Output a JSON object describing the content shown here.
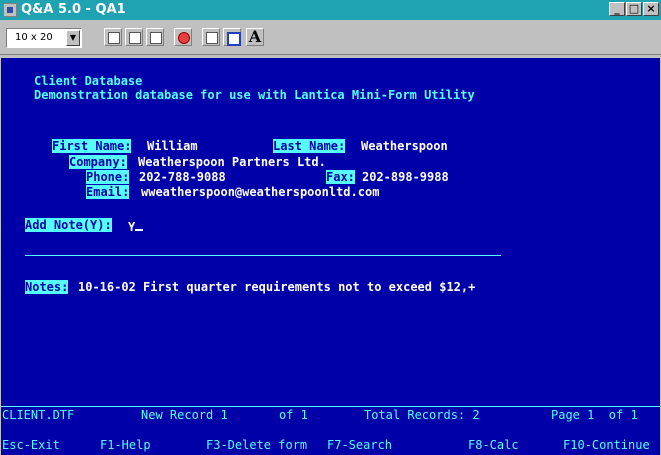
{
  "window": {
    "title": "Q&A 5.0 - QA1",
    "controls": [
      "_",
      "□",
      "×"
    ]
  },
  "toolbar": {
    "font_size": "10 x 20",
    "buttons": [
      "frame-icon",
      "copy-icon",
      "paste-icon",
      "lifesaver-icon",
      "properties-icon",
      "window-icon",
      "font-icon"
    ],
    "font_button": "A"
  },
  "form": {
    "db_title": "Client Database",
    "db_subtitle": "Demonstration database for use with Lantica Mini-Form Utility",
    "first_name_label": "First Name:",
    "first_name": "William",
    "last_name_label": "Last Name:",
    "last_name": "Weatherspoon",
    "company_label": "Company:",
    "company": "Weatherspoon Partners Ltd.",
    "phone_label": "Phone:",
    "phone": "202-788-9088",
    "fax_label": "Fax:",
    "fax": "202-898-9988",
    "email_label": "Email:",
    "email": "wweatherspoon@weatherspoonltd.com",
    "add_note_label": "Add Note(Y):",
    "add_note": "Y",
    "notes_label": "Notes:",
    "notes": "10-16-02 First quarter requirements not to exceed $12,+"
  },
  "status": {
    "file": "CLIENT.DTF",
    "record": "New Record 1",
    "of": "of 1",
    "total": "Total Records: 2",
    "page": "Page 1  of 1"
  },
  "fkeys": [
    "Esc-Exit",
    "F1-Help",
    "F3-Delete form",
    "F7-Search",
    "F8-Calc",
    "F10-Continue"
  ]
}
